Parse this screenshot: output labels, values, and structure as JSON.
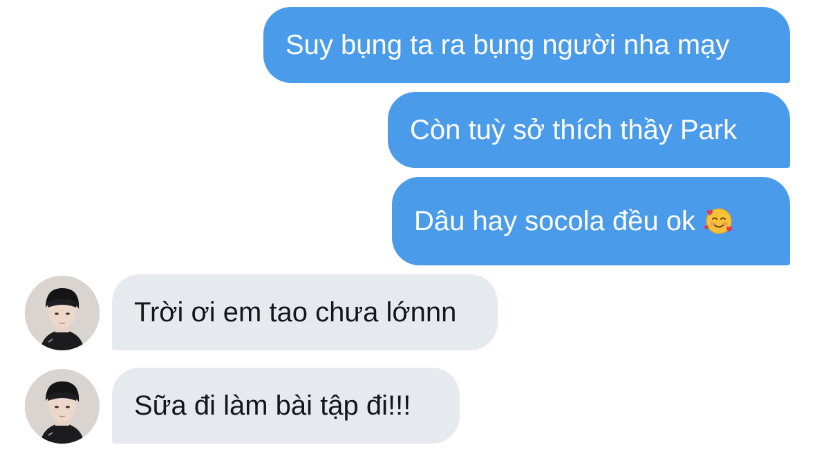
{
  "conversation": {
    "messages": [
      {
        "direction": "outgoing",
        "text": "Suy bụng ta ra bụng người nha mạy"
      },
      {
        "direction": "outgoing",
        "text": "Còn tuỳ sở thích thầy Park"
      },
      {
        "direction": "outgoing",
        "text": "Dâu hay socola đều ok",
        "emoji": "smiling-face-with-hearts-emoji"
      },
      {
        "direction": "incoming",
        "text": "Trời ơi em tao chưa lớnnn",
        "avatar": "avatar"
      },
      {
        "direction": "incoming",
        "text": "Sữa đi làm bài tập đi!!!",
        "avatar": "avatar"
      }
    ]
  },
  "colors": {
    "outgoing_bubble": "#4a9bea",
    "incoming_bubble": "#e6eaef",
    "outgoing_text": "#ffffff",
    "incoming_text": "#14171a"
  }
}
